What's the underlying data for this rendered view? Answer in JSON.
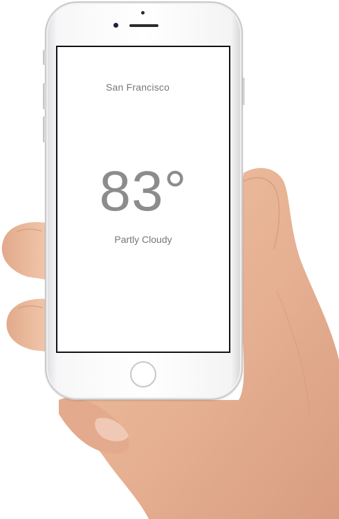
{
  "weather": {
    "city": "San Francisco",
    "temperature": "83°",
    "condition": "Partly Cloudy"
  },
  "colors": {
    "text_secondary": "#777777",
    "temperature_text": "#8c8c8c",
    "skin": "#e8b497",
    "phone_body": "#f5f5f6"
  },
  "icons": {
    "home_button": "home-button-icon",
    "front_camera": "front-camera-icon",
    "speaker": "earpiece-speaker-icon"
  }
}
